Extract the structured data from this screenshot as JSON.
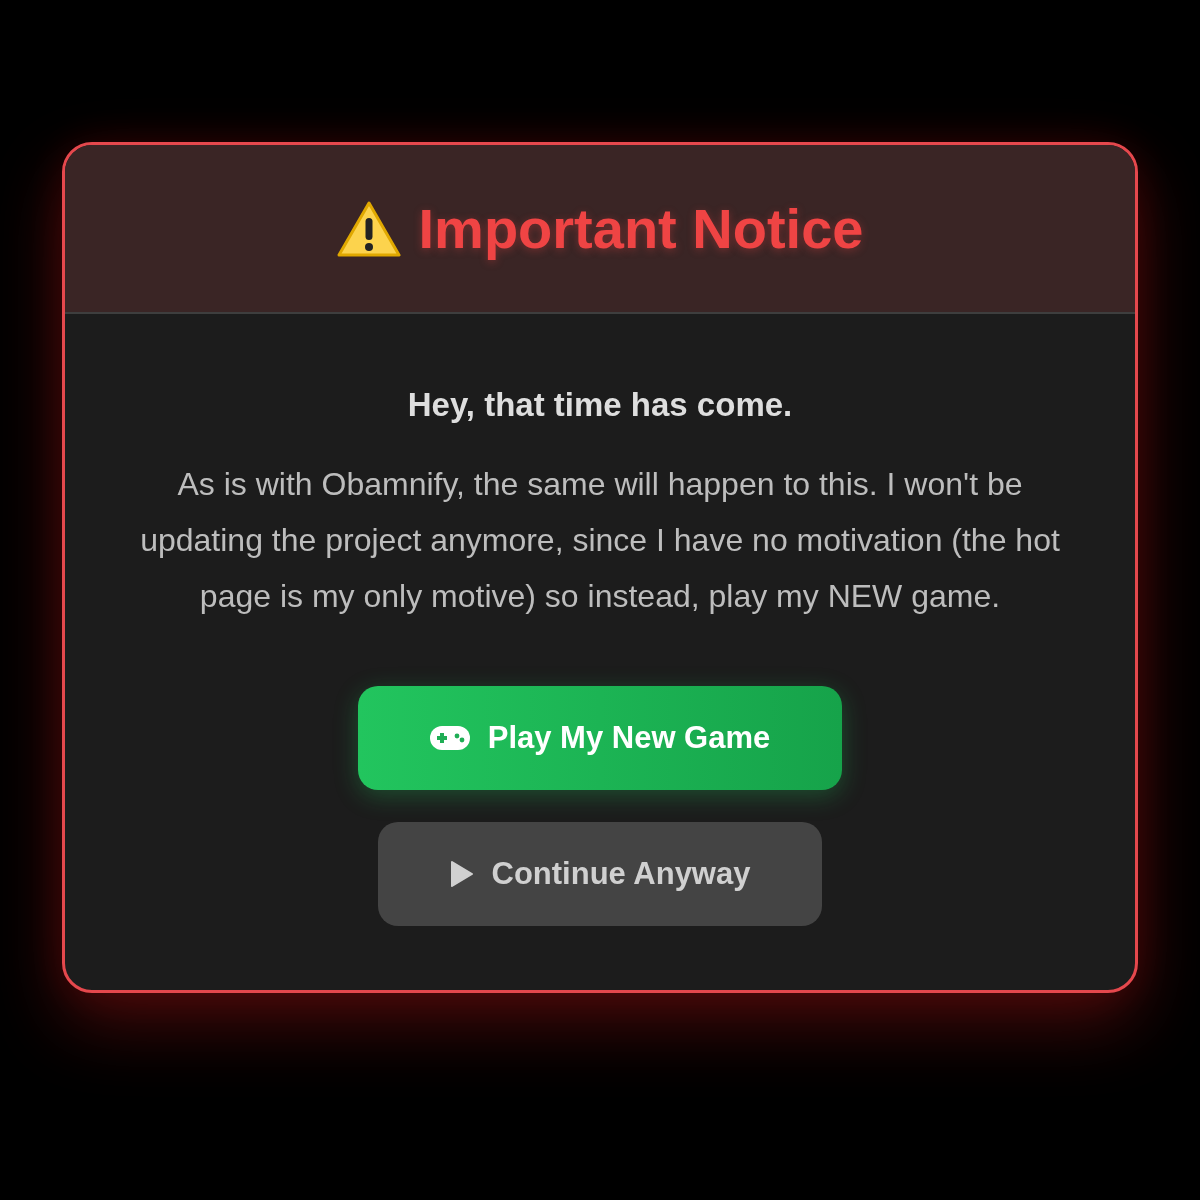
{
  "dialog": {
    "title": "Important Notice",
    "subtitle": "Hey, that time has come.",
    "message": "As is with Obamnify, the same will happen to this. I won't be updating the project anymore, since I have no motivation (the hot page is my only motive) so instead, play my NEW game.",
    "buttons": [
      {
        "label": "Play My New Game",
        "kind": "primary"
      },
      {
        "label": "Continue Anyway",
        "kind": "secondary"
      }
    ]
  }
}
